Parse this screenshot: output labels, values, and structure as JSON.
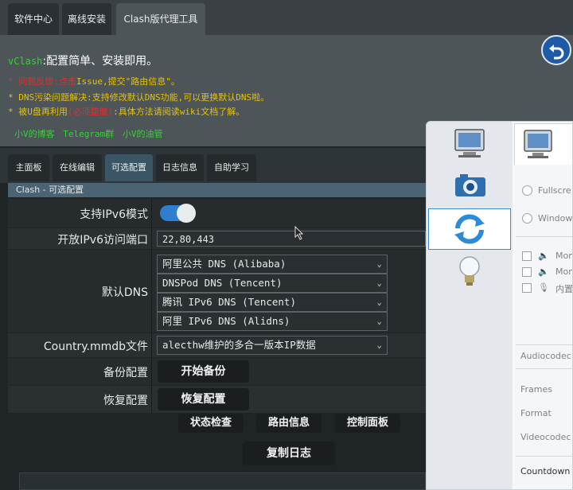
{
  "top_tabs": [
    "软件中心",
    "离线安装",
    "Clash版代理工具"
  ],
  "header": {
    "title_prefix": "vClash",
    "title_rest": ":配置简单、安装即用。",
    "line1_prefix": "* ",
    "line1_red": "问题反馈:点击",
    "line1_issue": "Issue",
    "line1_suffix": ",提交\"路由信息\"。",
    "line2": "* DNS污染问题解决:支持修改默认DNS功能,可以更换默认DNS啦。",
    "line3_prefix": "* 被U盘再利用",
    "line3_red": "(必须整傻)",
    "line3_mid": ":具体方法请阅读",
    "line3_wiki": "wiki",
    "line3_suffix": "文档了解。",
    "links": [
      "小V的博客",
      "Telegram群",
      "小V的油管"
    ]
  },
  "sub_tabs": [
    "主面板",
    "在线编辑",
    "可选配置",
    "日志信息",
    "自助学习"
  ],
  "panel_title": "Clash - 可选配置",
  "form": {
    "ipv6_label": "支持IPv6模式",
    "port_label": "开放IPv6访问端口",
    "port_value": "22,80,443",
    "dns_label": "默认DNS",
    "dns_options": [
      "阿里公共 DNS (Alibaba)",
      "DNSPod DNS (Tencent)",
      "腾讯 IPv6 DNS (Tencent)",
      "阿里 IPv6 DNS (Alidns)"
    ],
    "mmdb_label": "Country.mmdb文件",
    "mmdb_value": "alecthw维护的多合一版本IP数据",
    "backup_label": "备份配置",
    "backup_btn": "开始备份",
    "restore_label": "恢复配置",
    "restore_btn": "恢复配置"
  },
  "actions": [
    "状态检查",
    "路由信息",
    "控制面板"
  ],
  "copy_log": "复制日志",
  "overlay": {
    "radio1": "Fullscre",
    "radio2": "Window",
    "check1": "Mon",
    "check2": "Mon",
    "check3": "内置",
    "audio": "Audiocodec",
    "frames": "Frames",
    "format": "Format",
    "video": "Videocodec",
    "countdown": "Countdown"
  },
  "colors": {
    "green": "#35d135",
    "red": "#e03030",
    "yellow": "#e6c200",
    "toggle_on": "#2f7fd0"
  }
}
